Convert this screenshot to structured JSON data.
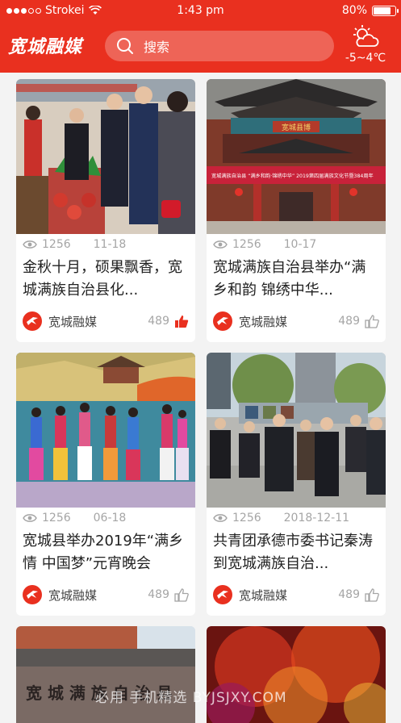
{
  "status_bar": {
    "carrier": "Strokei",
    "time": "1:43 pm",
    "battery": "80%",
    "battery_level": 0.8
  },
  "header": {
    "logo": "宽城融媒",
    "search_placeholder": "搜索",
    "weather_icon": "partly-cloudy-icon",
    "temperature": "-5~4℃"
  },
  "cards": [
    {
      "views": "1256",
      "date": "11-18",
      "title_line1": "金秋十月，硕果飘香，宽",
      "title_line2": "城满族自治县化...",
      "source": "宽城融媒",
      "likes": "489",
      "liked": true
    },
    {
      "views": "1256",
      "date": "10-17",
      "title_line1": "宽城满族自治县举办“满",
      "title_line2": "乡和韵 锦绣中华...",
      "source": "宽城融媒",
      "likes": "489",
      "liked": false
    },
    {
      "views": "1256",
      "date": "06-18",
      "title_line1": "宽城县举办2019年“满乡",
      "title_line2": "情 中国梦”元宵晚会",
      "source": "宽城融媒",
      "likes": "489",
      "liked": false
    },
    {
      "views": "1256",
      "date": "2018-12-11",
      "title_line1": "共青团承德市委书记秦涛",
      "title_line2": "到宽城满族自治...",
      "source": "宽城融媒",
      "likes": "489",
      "liked": false
    }
  ],
  "photo_banners": {
    "card1_sign": "宽城满族自治县 “满乡和韵·锦绣中华” 2019第四届满族文化节暨384周年",
    "card1_plaque": "宽城县博",
    "card5_sign": "宽 城 满 族 自 治 县"
  },
  "watermark": "必用 手机精选 BYJSJXY.COM",
  "colors": {
    "brand_red": "#e9301f",
    "muted": "#a5a5a5"
  }
}
